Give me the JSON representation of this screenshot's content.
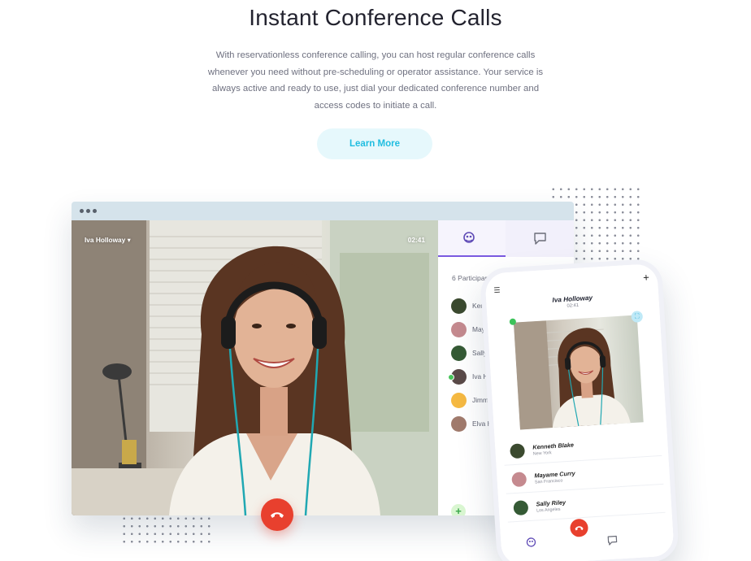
{
  "hero": {
    "title": "Instant Conference Calls",
    "description": "With reservationless conference calling, you can host regular conference calls whenever you need without pre-scheduling or operator assistance. Your service is always active and ready to use, just dial your dedicated conference number and access codes to initiate a call.",
    "cta_label": "Learn More"
  },
  "desktop_call": {
    "caller_name": "Iva Holloway",
    "call_time": "02:41",
    "participants_label": "6 Participants",
    "participants": [
      {
        "name": "Kenneth Blake",
        "color": "#3b4a2f",
        "online": false
      },
      {
        "name": "Mayme Curry",
        "color": "#c58a8f",
        "online": false
      },
      {
        "name": "Sally Riley",
        "color": "#355a35",
        "online": false
      },
      {
        "name": "Iva Holloway",
        "color": "#5a4a48",
        "online": true
      },
      {
        "name": "Jimmy Warne",
        "color": "#f5b942",
        "online": false
      },
      {
        "name": "Elva Holt",
        "color": "#a07a6c",
        "online": false
      }
    ],
    "add_label": "+"
  },
  "mobile_call": {
    "caller_name": "Iva Holloway",
    "call_time": "02:41",
    "participants": [
      {
        "name": "Kenneth Blake",
        "location": "New York",
        "color": "#3b4a2f"
      },
      {
        "name": "Mayame Curry",
        "location": "San Francisco",
        "color": "#c58a8f"
      },
      {
        "name": "Sally Riley",
        "location": "Los Angeles",
        "color": "#355a35"
      }
    ]
  },
  "colors": {
    "accent": "#20bde0",
    "hangup": "#e8402e",
    "tab_active": "#7a5ae0",
    "online": "#47c45a"
  }
}
